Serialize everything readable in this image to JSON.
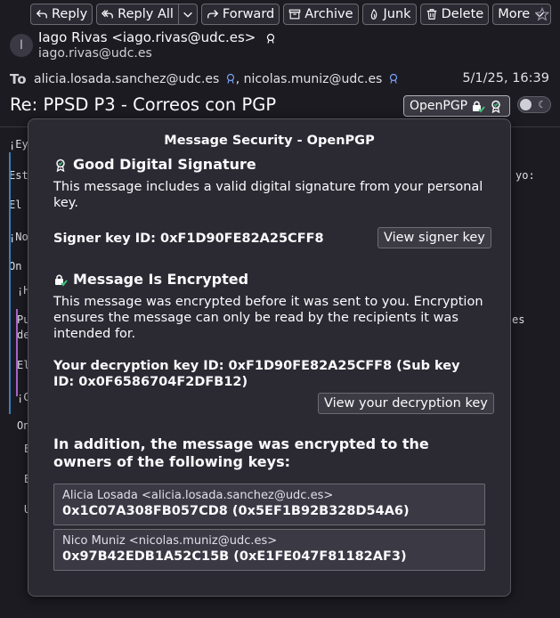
{
  "toolbar": {
    "reply": "Reply",
    "reply_all": "Reply All",
    "forward": "Forward",
    "archive": "Archive",
    "junk": "Junk",
    "delete": "Delete",
    "more": "More"
  },
  "header": {
    "avatar_letter": "I",
    "from_name": "Iago Rivas <iago.rivas@udc.es>",
    "from_email": "iago.rivas@udc.es",
    "to_label": "To",
    "to_1": "alicia.losada.sanchez@udc.es",
    "to_sep": ", ",
    "to_2": "nicolas.muniz@udc.es",
    "date": "5/1/25, 16:39",
    "subject": "Re: PPSD P3 - Correos con PGP",
    "openpgp_label": "OpenPGP"
  },
  "body_lines": [
    "¡Ey",
    "Est",
    "El",
    "¡No",
    "On",
    "¡H",
    "Pu",
    "de",
    "El",
    "¡C",
    "On",
    "E",
    "E",
    "U"
  ],
  "body_right": {
    "yo": "yo:",
    "es": "es"
  },
  "popup": {
    "title": "Message Security - OpenPGP",
    "signature_heading": "Good Digital Signature",
    "signature_text": "This message includes a valid digital signature from your personal key.",
    "signer_key": "Signer key ID: 0xF1D90FE82A25CFF8",
    "view_signer_key": "View signer key",
    "encryption_heading": "Message Is Encrypted",
    "encryption_text": "This message was encrypted before it was sent to you. Encryption ensures the message can only be read by the recipients it was intended for.",
    "decryption_key": "Your decryption key ID: 0xF1D90FE82A25CFF8 (Sub key ID: 0x0F6586704F2DFB12)",
    "view_decryption_key": "View your decryption key",
    "addition_text": "In addition, the message was encrypted to the owners of the following keys:",
    "keys": [
      {
        "name": "Alicia Losada <alicia.losada.sanchez@udc.es>",
        "id": "0x1C07A308FB057CD8 (0x5EF1B92B328D54A6)"
      },
      {
        "name": "Nico Muniz <nicolas.muniz@udc.es>",
        "id": "0x97B42EDB1A52C15B (0xE1FE047F81182AF3)"
      }
    ]
  },
  "colors": {
    "background": "#1c1b22",
    "panel": "#2b2a33",
    "verified_green": "#3fc27a",
    "link_blue": "#7aa2f7"
  }
}
